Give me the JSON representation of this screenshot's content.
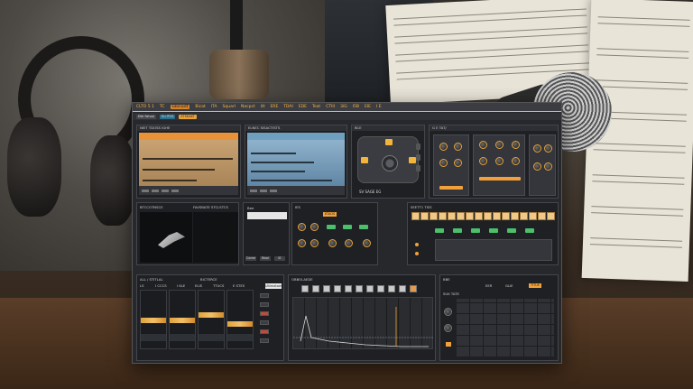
{
  "menubar": {
    "items": [
      "CLTO 5 1",
      "TC",
      "Bicat",
      "ITA",
      "Squarl",
      "Nacpct",
      "itt",
      "ERE",
      "TDAl",
      "EDE",
      "Teat",
      "CTIII",
      "3iG",
      "I5B",
      "EIE",
      "I E"
    ],
    "badge": "Gbinadt"
  },
  "toolbar": {
    "buttons": [
      "Elbl Fatuul",
      "Su ITCS",
      "STSEAKT"
    ]
  },
  "panels": {
    "editor1_title": "NEIT TDOSS IGHE",
    "editor2_title": "ELNEC SISACTISTS",
    "synth_title": "BCE",
    "synth_label": "SV SAGE EG",
    "rack_title": "G E TAT/",
    "preview_title": "BTCCOTNSCE",
    "preview_title2": "FAVSBATE STCLSTCS",
    "mini_label": "Bee",
    "mini_btns": [
      "Come",
      "Bbal",
      "IE"
    ],
    "mixer_title": "IES",
    "mixer_badge": "KTAOS",
    "seq_title": "SEETT1 TSIS",
    "faders_title": "ALL / STITLAL",
    "faders_title2": "BICTERCE",
    "fader_labels": [
      "LS",
      "I CCCS",
      "I KLE",
      "ELIS",
      "TTUCS",
      "E STES"
    ],
    "white_tag": "Ultimatoes",
    "env_title": "OBBOLAEDE",
    "matrix_title": "BBE",
    "matrix_tags": [
      "EER",
      "GLIE",
      "TITUE"
    ],
    "matrix_sub": "SUK TATE"
  },
  "colors": {
    "accent": "#f2a13a",
    "panel_bg": "#1e2023",
    "window_bg": "#26282c"
  }
}
